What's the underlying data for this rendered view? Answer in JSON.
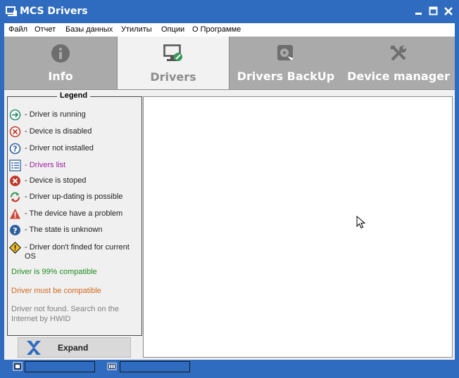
{
  "window": {
    "title": "MCS Drivers",
    "icons": {
      "app": "app-window-icon",
      "minimize": "minimize-icon",
      "maximize": "maximize-icon",
      "close": "close-icon"
    }
  },
  "menu": [
    "Файл",
    "Отчет",
    "Базы данных",
    "Утилиты",
    "Опции",
    "О Программе"
  ],
  "tabs": [
    {
      "label": "Info",
      "icon": "info-icon",
      "active": false
    },
    {
      "label": "Drivers",
      "icon": "monitor-wrench-icon",
      "active": true
    },
    {
      "label": "Drivers BackUp",
      "icon": "backup-icon",
      "active": false
    },
    {
      "label": "Device manager",
      "icon": "tools-icon",
      "active": false
    }
  ],
  "legend": {
    "title": "Legend",
    "items": [
      {
        "icon": "arrow-right-circle-icon",
        "text": "- Driver is running",
        "color": "#222222"
      },
      {
        "icon": "x-circle-outline-icon",
        "text": "- Device is disabled",
        "color": "#222222"
      },
      {
        "icon": "question-circle-outline-icon",
        "text": "- Driver not installed",
        "color": "#222222"
      },
      {
        "icon": "list-icon",
        "text": "- Drivers list",
        "color": "#a020a0"
      },
      {
        "icon": "x-circle-filled-icon",
        "text": "- Device is stoped",
        "color": "#222222"
      },
      {
        "icon": "refresh-icon",
        "text": "- Driver up-dating is possible",
        "color": "#222222"
      },
      {
        "icon": "warning-triangle-icon",
        "text": "- The device have a problem",
        "color": "#222222"
      },
      {
        "icon": "question-circle-filled-icon",
        "text": "- The state is unknown",
        "color": "#222222"
      },
      {
        "icon": "warning-diamond-icon",
        "text": "- Driver don't finded for current OS",
        "color": "#222222"
      }
    ],
    "notes": [
      {
        "text": "Driver is 99% compatible",
        "color": "#1e8c1e"
      },
      {
        "text": "Driver must be compatible",
        "color": "#d2691e"
      },
      {
        "text": "Driver not found. Search on the Internet by HWID",
        "color": "#808080"
      }
    ]
  },
  "expand_button": {
    "label": "Expand",
    "icon": "expand-x-icon"
  },
  "status": {
    "icons": [
      "chip-icon",
      "memory-icon"
    ]
  },
  "colors": {
    "titlebar": "#2f6bbf",
    "tab_inactive": "#aaaaaa",
    "tab_active": "#f2f2f2"
  }
}
